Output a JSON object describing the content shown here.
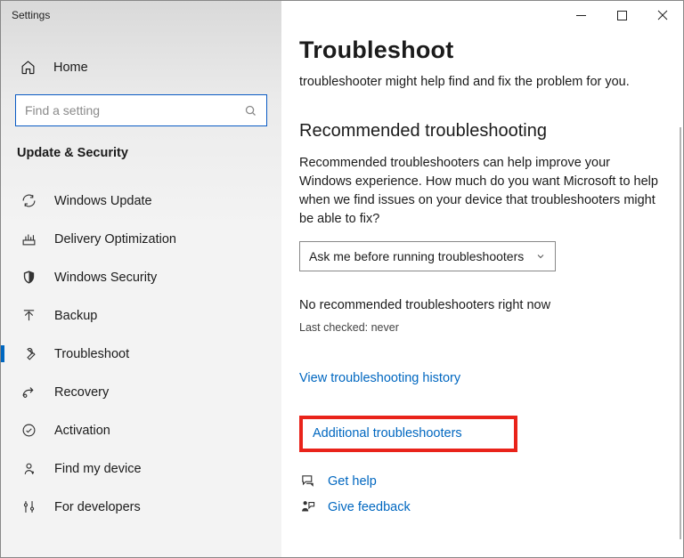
{
  "window": {
    "title": "Settings"
  },
  "sidebar": {
    "home_label": "Home",
    "search_placeholder": "Find a setting",
    "section_title": "Update & Security",
    "items": [
      {
        "label": "Windows Update",
        "icon": "sync"
      },
      {
        "label": "Delivery Optimization",
        "icon": "download-box"
      },
      {
        "label": "Windows Security",
        "icon": "shield"
      },
      {
        "label": "Backup",
        "icon": "arrow-up"
      },
      {
        "label": "Troubleshoot",
        "icon": "wrench",
        "active": true
      },
      {
        "label": "Recovery",
        "icon": "recovery"
      },
      {
        "label": "Activation",
        "icon": "check-circle"
      },
      {
        "label": "Find my device",
        "icon": "locate"
      },
      {
        "label": "For developers",
        "icon": "sliders"
      }
    ]
  },
  "main": {
    "heading": "Troubleshoot",
    "intro": "troubleshooter might help find and fix the problem for you.",
    "section_heading": "Recommended troubleshooting",
    "section_body": "Recommended troubleshooters can help improve your Windows experience. How much do you want Microsoft to help when we find issues on your device that troubleshooters might be able to fix?",
    "dropdown_value": "Ask me before running troubleshooters",
    "status": "No recommended troubleshooters right now",
    "last_checked": "Last checked: never",
    "link_history": "View troubleshooting history",
    "link_additional": "Additional troubleshooters",
    "link_help": "Get help",
    "link_feedback": "Give feedback"
  }
}
